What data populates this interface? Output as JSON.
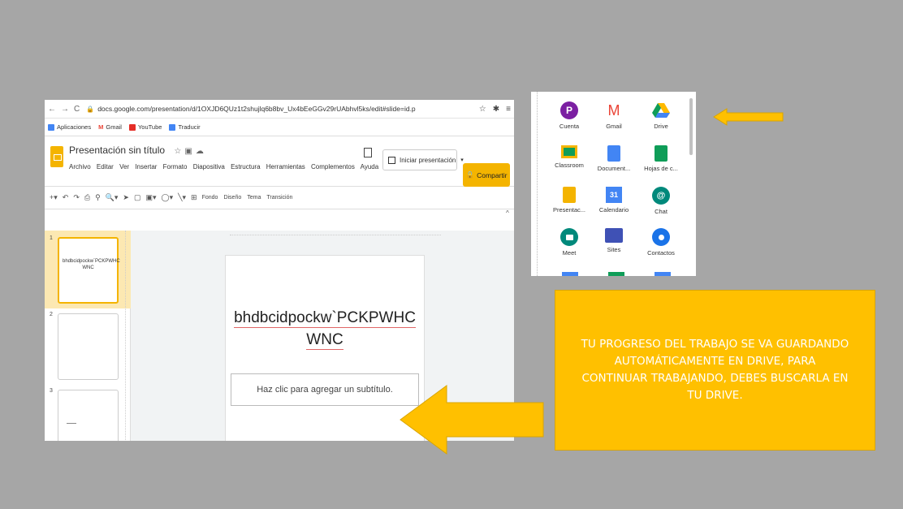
{
  "browser": {
    "url": "docs.google.com/presentation/d/1OXJD6QUz1t2shujlq6b8bv_Ux4bEeGGv29rUAbhvl5ks/edit#slide=id.p",
    "bookmarks": [
      "Aplicaciones",
      "Gmail",
      "YouTube",
      "Traducir"
    ]
  },
  "slides_app": {
    "doc_title": "Presentación sin título",
    "menu": [
      "Archivo",
      "Editar",
      "Ver",
      "Insertar",
      "Formato",
      "Diapositiva",
      "Estructura",
      "Herramientas",
      "Complementos",
      "Ayuda"
    ],
    "present_label": "Iniciar presentación",
    "share_label": "Compartir",
    "toolbar_text": [
      "Fondo",
      "Diseño",
      "Tema",
      "Transición"
    ],
    "thumbnails": [
      {
        "num": "1",
        "text": "bhdbcidpockw`PCKPWHC WNC"
      },
      {
        "num": "2",
        "text": ""
      },
      {
        "num": "3",
        "text": ""
      }
    ],
    "slide_title_line1": "bhdbcidpockw`PCKPWHC",
    "slide_title_line2": "WNC",
    "subtitle_placeholder": "Haz clic para agregar un subtítulo."
  },
  "apps_panel": {
    "apps": [
      {
        "label": "Cuenta",
        "icon": "account-icon",
        "color": "#7b1fa2",
        "glyph": "P"
      },
      {
        "label": "Gmail",
        "icon": "gmail-icon",
        "color": "#ea4335",
        "glyph": "M"
      },
      {
        "label": "Drive",
        "icon": "drive-icon",
        "color": "#0f9d58",
        "glyph": ""
      },
      {
        "label": "Classroom",
        "icon": "classroom-icon",
        "color": "#0f9d58",
        "glyph": ""
      },
      {
        "label": "Document...",
        "icon": "docs-icon",
        "color": "#4285f4",
        "glyph": ""
      },
      {
        "label": "Hojas de c...",
        "icon": "sheets-icon",
        "color": "#0f9d58",
        "glyph": ""
      },
      {
        "label": "Presentac...",
        "icon": "slides-icon",
        "color": "#f4b400",
        "glyph": ""
      },
      {
        "label": "Calendario",
        "icon": "calendar-icon",
        "color": "#4285f4",
        "glyph": "31"
      },
      {
        "label": "Chat",
        "icon": "chat-icon",
        "color": "#00897b",
        "glyph": "@"
      },
      {
        "label": "Meet",
        "icon": "meet-icon",
        "color": "#00897b",
        "glyph": ""
      },
      {
        "label": "Sites",
        "icon": "sites-icon",
        "color": "#3f51b5",
        "glyph": ""
      },
      {
        "label": "Contactos",
        "icon": "contacts-icon",
        "color": "#1a73e8",
        "glyph": ""
      }
    ]
  },
  "message": {
    "text": "TU PROGRESO DEL TRABAJO SE VA GUARDANDO AUTOMÁTICAMENTE EN DRIVE, PARA CONTINUAR TRABAJANDO, DEBES BUSCARLA EN TU DRIVE."
  },
  "colors": {
    "accent": "#ffc000",
    "background": "#a6a6a6"
  }
}
